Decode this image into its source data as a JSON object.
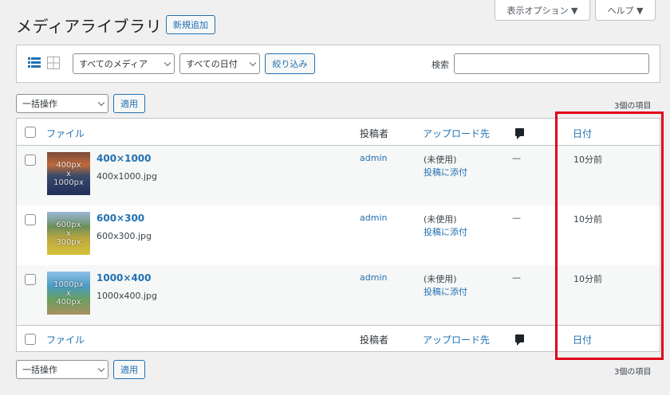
{
  "page_title": "メディアライブラリ",
  "add_new_label": "新規追加",
  "screen_options_label": "表示オプション ▼",
  "help_label": "ヘルプ ▼",
  "filter": {
    "media_type_label": "すべてのメディア",
    "date_label": "すべての日付",
    "filter_button_label": "絞り込み",
    "search_label": "検索",
    "search_value": ""
  },
  "bulk_top": {
    "select_label": "一括操作",
    "apply_label": "適用",
    "count": "3個の項目"
  },
  "bulk_bottom": {
    "select_label": "一括操作",
    "apply_label": "適用",
    "count": "3個の項目"
  },
  "columns": {
    "file": "ファイル",
    "author": "投稿者",
    "uploaded_to": "アップロード先",
    "date": "日付"
  },
  "rows": [
    {
      "title": "400×1000",
      "filename": "400x1000.jpg",
      "thumb_text": "400px\nx\n1000px",
      "author": "admin",
      "uploaded_status": "(未使用)",
      "attach_link": "投稿に添付",
      "comments": "—",
      "date": "10分前"
    },
    {
      "title": "600×300",
      "filename": "600x300.jpg",
      "thumb_text": "600px\nx\n300px",
      "author": "admin",
      "uploaded_status": "(未使用)",
      "attach_link": "投稿に添付",
      "comments": "—",
      "date": "10分前"
    },
    {
      "title": "1000×400",
      "filename": "1000x400.jpg",
      "thumb_text": "1000px\nx\n400px",
      "author": "admin",
      "uploaded_status": "(未使用)",
      "attach_link": "投稿に添付",
      "comments": "—",
      "date": "10分前"
    }
  ],
  "colors": {
    "link": "#2271b1",
    "highlight": "#e0001a"
  }
}
